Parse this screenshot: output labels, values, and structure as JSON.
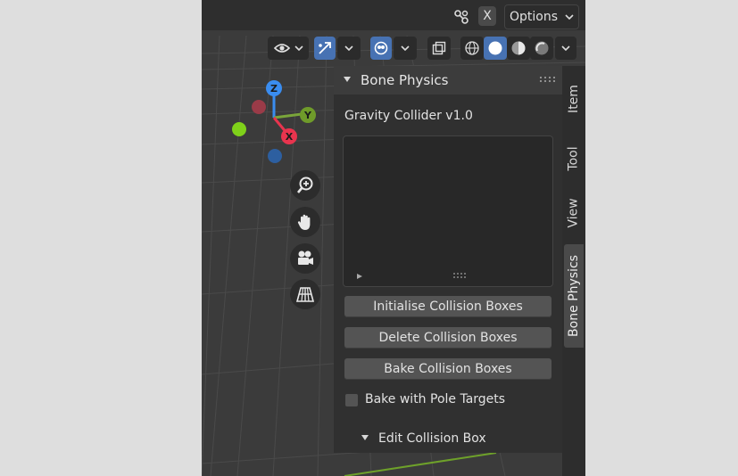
{
  "header": {
    "x_label": "X",
    "options_label": "Options"
  },
  "gizmo": {
    "z": "Z",
    "y": "Y",
    "x": "X"
  },
  "panel": {
    "title": "Bone Physics",
    "addon_title": "Gravity Collider v1.0",
    "buttons": {
      "initialise": "Initialise Collision Boxes",
      "delete": "Delete Collision Boxes",
      "bake": "Bake Collision Boxes"
    },
    "bake_with_pole_targets": {
      "label": "Bake with Pole Targets",
      "checked": false
    },
    "edit_collision_box": "Edit Collision Box"
  },
  "tabs": [
    "Item",
    "Tool",
    "View",
    "Bone Physics"
  ],
  "active_tab": "Bone Physics",
  "colors": {
    "accent_blue": "#4772b3",
    "axis_x": "#e8344e",
    "axis_y": "#6f9b2a",
    "axis_z": "#3a8df0"
  }
}
